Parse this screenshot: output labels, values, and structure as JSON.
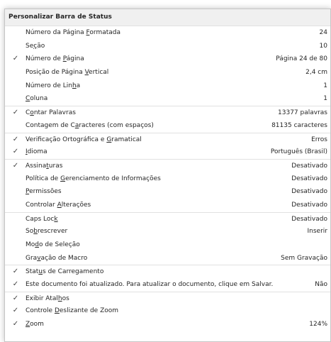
{
  "title": "Personalizar Barra de Status",
  "check_glyph": "✓",
  "items": [
    {
      "label_pre": "Número da Página ",
      "label_key": "F",
      "label_post": "ormatada",
      "value": "24",
      "checked": false,
      "sep": false
    },
    {
      "label_pre": "Se",
      "label_key": "ç",
      "label_post": "ão",
      "value": "10",
      "checked": false,
      "sep": false
    },
    {
      "label_pre": "Número de ",
      "label_key": "P",
      "label_post": "ágina",
      "value": "Página 24 de 80",
      "checked": true,
      "sep": false
    },
    {
      "label_pre": "Posição de Página ",
      "label_key": "V",
      "label_post": "ertical",
      "value": "2,4 cm",
      "checked": false,
      "sep": false
    },
    {
      "label_pre": "Número de Lin",
      "label_key": "h",
      "label_post": "a",
      "value": "1",
      "checked": false,
      "sep": false
    },
    {
      "label_pre": "",
      "label_key": "C",
      "label_post": "oluna",
      "value": "1",
      "checked": false,
      "sep": false
    },
    {
      "label_pre": "C",
      "label_key": "o",
      "label_post": "ntar Palavras",
      "value": "13377 palavras",
      "checked": true,
      "sep": true
    },
    {
      "label_pre": "Contagem de C",
      "label_key": "a",
      "label_post": "racteres (com espaços)",
      "value": "81135 caracteres",
      "checked": false,
      "sep": false
    },
    {
      "label_pre": "Verificação Ortográfica e ",
      "label_key": "G",
      "label_post": "ramatical",
      "value": "Erros",
      "checked": true,
      "sep": true
    },
    {
      "label_pre": "",
      "label_key": "I",
      "label_post": "dioma",
      "value": "Português (Brasil)",
      "checked": true,
      "sep": false
    },
    {
      "label_pre": "Assina",
      "label_key": "t",
      "label_post": "uras",
      "value": "Desativado",
      "checked": true,
      "sep": true
    },
    {
      "label_pre": "Política de ",
      "label_key": "G",
      "label_post": "erenciamento de Informações",
      "value": "Desativado",
      "checked": false,
      "sep": false
    },
    {
      "label_pre": "",
      "label_key": "P",
      "label_post": "ermissões",
      "value": "Desativado",
      "checked": false,
      "sep": false
    },
    {
      "label_pre": "Controlar ",
      "label_key": "A",
      "label_post": "lterações",
      "value": "Desativado",
      "checked": false,
      "sep": false
    },
    {
      "label_pre": "Caps Loc",
      "label_key": "k",
      "label_post": "",
      "value": "Desativado",
      "checked": false,
      "sep": true
    },
    {
      "label_pre": "So",
      "label_key": "b",
      "label_post": "rescrever",
      "value": "Inserir",
      "checked": false,
      "sep": false
    },
    {
      "label_pre": "Mo",
      "label_key": "d",
      "label_post": "o de Seleção",
      "value": "",
      "checked": false,
      "sep": false
    },
    {
      "label_pre": "Gra",
      "label_key": "v",
      "label_post": "ação de Macro",
      "value": "Sem Gravação",
      "checked": false,
      "sep": false
    },
    {
      "label_pre": "Stat",
      "label_key": "u",
      "label_post": "s de Carregamento",
      "value": "",
      "checked": true,
      "sep": true
    },
    {
      "label_pre": "Este documento foi atualizado. Para atualizar o documento, clique em Salvar.",
      "label_key": "",
      "label_post": "",
      "value": "Não",
      "checked": true,
      "sep": false
    },
    {
      "label_pre": "Exibir Atal",
      "label_key": "h",
      "label_post": "os",
      "value": "",
      "checked": true,
      "sep": true
    },
    {
      "label_pre": "Controle ",
      "label_key": "D",
      "label_post": "eslizante de Zoom",
      "value": "",
      "checked": true,
      "sep": false
    },
    {
      "label_pre": "",
      "label_key": "Z",
      "label_post": "oom",
      "value": "124%",
      "checked": true,
      "sep": false
    }
  ]
}
